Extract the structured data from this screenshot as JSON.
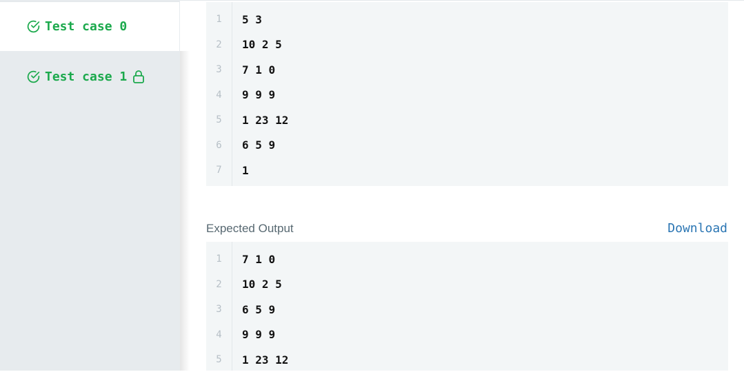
{
  "tabs": [
    {
      "label": "Test case 0",
      "status": "passed",
      "locked": false
    },
    {
      "label": "Test case 1",
      "status": "passed",
      "locked": true
    }
  ],
  "input": {
    "lines": [
      "5 3",
      "10 2 5",
      "7 1 0",
      "9 9 9",
      "1 23 12",
      "6 5 9",
      "1"
    ]
  },
  "expected_output": {
    "label": "Expected Output",
    "download_label": "Download",
    "lines": [
      "7 1 0",
      "10 2 5",
      "6 5 9",
      "9 9 9",
      "1 23 12"
    ]
  },
  "colors": {
    "success": "#1ba94c",
    "link": "#2a75b3",
    "code_bg": "#f3f6f7",
    "sidebar_bg": "#e7ebee"
  },
  "icons": {
    "status": "check-circle-icon",
    "locked": "lock-icon"
  }
}
